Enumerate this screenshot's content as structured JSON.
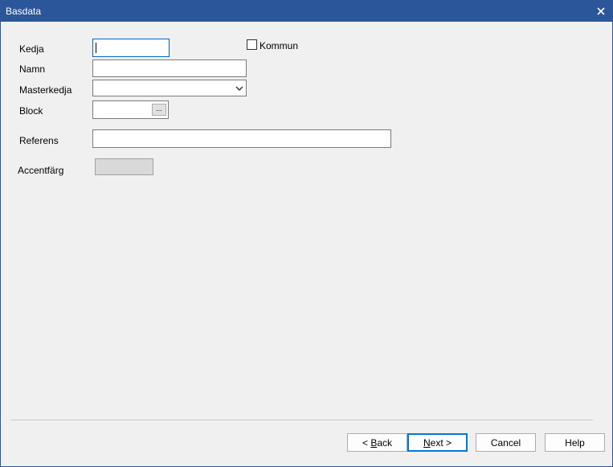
{
  "window": {
    "title": "Basdata",
    "close_glyph": "✕"
  },
  "form": {
    "kedja": {
      "label": "Kedja",
      "value": ""
    },
    "kommun": {
      "label": "Kommun",
      "checked": false
    },
    "namn": {
      "label": "Namn",
      "value": ""
    },
    "masterkedja": {
      "label": "Masterkedja",
      "selected": ""
    },
    "block": {
      "label": "Block",
      "value": "",
      "browse_label": "..."
    },
    "referens": {
      "label": "Referens",
      "value": ""
    },
    "accentfarg": {
      "label": "Accentfärg",
      "color": "#d9d9d9"
    }
  },
  "buttons": {
    "back": {
      "prefix": "< ",
      "mnemonic": "B",
      "rest": "ack"
    },
    "next": {
      "mnemonic": "N",
      "rest": "ext >"
    },
    "cancel": {
      "label": "Cancel"
    },
    "help": {
      "label": "Help"
    }
  },
  "colors": {
    "titlebar": "#2b579a",
    "focus": "#0066cc",
    "default_button": "#0078d7"
  },
  "icons": {
    "close": "close-icon",
    "dropdown": "chevron-down-icon",
    "browse": "ellipsis-icon"
  }
}
